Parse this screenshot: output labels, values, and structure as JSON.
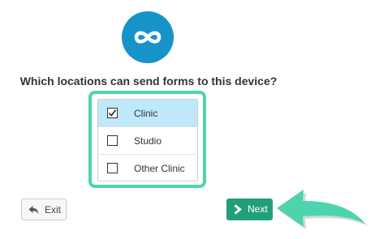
{
  "logo": {
    "icon": "infinity-icon",
    "color": "#1693c9"
  },
  "question": "Which locations can send forms to this device?",
  "locations": [
    {
      "label": "Clinic",
      "checked": true,
      "selected": true
    },
    {
      "label": "Studio",
      "checked": false,
      "selected": false
    },
    {
      "label": "Other Clinic",
      "checked": false,
      "selected": false
    }
  ],
  "buttons": {
    "exit": {
      "label": "Exit",
      "icon": "reply-arrow-icon"
    },
    "next": {
      "label": "Next",
      "icon": "chevron-right-icon",
      "color": "#229f79"
    }
  },
  "colors": {
    "highlight_frame": "#4dd4ac",
    "selected_row": "#bfe8fb",
    "pointer_arrow": "#4dd4ac"
  }
}
